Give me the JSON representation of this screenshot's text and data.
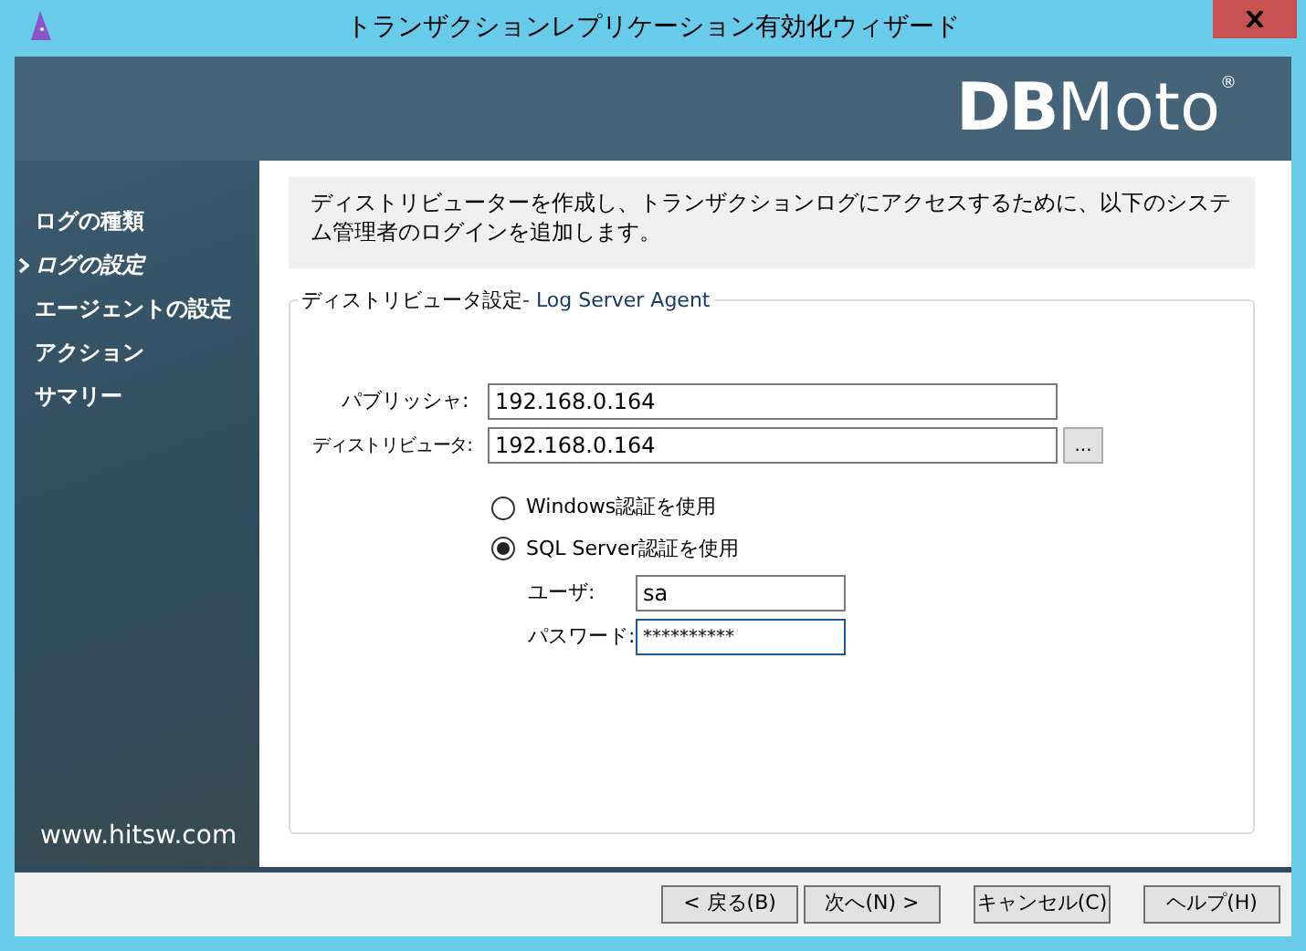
{
  "window": {
    "title": "トランザクションレプリケーション有効化ウィザード"
  },
  "banner": {
    "logo_bold": "DB",
    "logo_light": "Moto",
    "logo_mark": "®"
  },
  "sidebar": {
    "items": [
      {
        "label": "ログの種類",
        "selected": false
      },
      {
        "label": "ログの設定",
        "selected": true
      },
      {
        "label": "エージェントの設定",
        "selected": false
      },
      {
        "label": "アクション",
        "selected": false
      },
      {
        "label": "サマリー",
        "selected": false
      }
    ],
    "footer": "www.hitsw.com"
  },
  "info": "ディストリビューターを作成し、トランザクションログにアクセスするために、以下のシステム管理者のログインを追加します。",
  "group": {
    "title": "ディストリビュータ設定",
    "subtitle": " - Log Server Agent",
    "publisher": {
      "label": "パブリッシャ:",
      "value": "192.168.0.164"
    },
    "distributor": {
      "label": "ディストリビュータ:",
      "value": "192.168.0.164",
      "browse": "..."
    },
    "auth": [
      {
        "label": "Windows認証を使用",
        "selected": false
      },
      {
        "label": "SQL Server認証を使用",
        "selected": true
      }
    ],
    "user": {
      "label": "ユーザ:",
      "value": "sa"
    },
    "password": {
      "label": "パスワード:",
      "value": "**********",
      "focused": true
    }
  },
  "buttons": [
    "< 戻る(B)",
    "次へ(N) >",
    "キャンセル(C)",
    "ヘルプ(H)"
  ]
}
